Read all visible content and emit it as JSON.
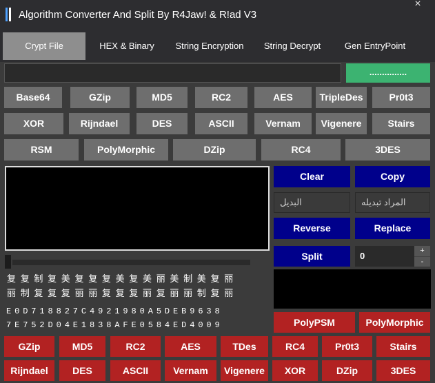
{
  "window": {
    "title": "Algorithm Converter And Split By R4Jaw! & R!ad V3",
    "close_label": "×"
  },
  "tabs": [
    {
      "label": "Crypt File",
      "active": true
    },
    {
      "label": "HEX & Binary",
      "active": false
    },
    {
      "label": "String Encryption",
      "active": false
    },
    {
      "label": "String Decrypt",
      "active": false
    },
    {
      "label": "Gen EntryPoint",
      "active": false
    }
  ],
  "path_input": {
    "value": ""
  },
  "browse_button": {
    "label": "..............."
  },
  "algo_row1": [
    "Base64",
    "GZip",
    "MD5",
    "RC2",
    "AES",
    "TripleDes",
    "Pr0t3"
  ],
  "algo_row2": [
    "XOR",
    "Rijndael",
    "DES",
    "ASCII",
    "Vernam",
    "Vigenere",
    "Stairs"
  ],
  "algo_row3": [
    "RSM",
    "PolyMorphic",
    "DZip",
    "RC4",
    "3DES"
  ],
  "actions": {
    "clear": "Clear",
    "copy": "Copy",
    "reverse": "Reverse",
    "replace": "Replace",
    "split": "Split"
  },
  "replace_with": {
    "placeholder": "البديل"
  },
  "to_replace": {
    "placeholder": "المراد تبديله"
  },
  "split_count": {
    "value": "0",
    "up": "+",
    "down": "-"
  },
  "preview": {
    "cjk_line1": "复复制复美复复复美复美丽美制美复丽",
    "cjk_line2": "丽制复复复丽丽复复复丽复丽丽制复丽",
    "hex_line1": "E0D718827C4921980A5DEB9638",
    "hex_line2": "7E752D04E1838AFE0584ED4009"
  },
  "poly_buttons": [
    "PolyPSM",
    "PolyMorphic"
  ],
  "red_row1": [
    "GZip",
    "MD5",
    "RC2",
    "AES",
    "TDes",
    "RC4",
    "Pr0t3",
    "Stairs"
  ],
  "red_row2": [
    "Rijndael",
    "DES",
    "ASCII",
    "Vernam",
    "Vigenere",
    "XOR",
    "DZip",
    "3DES"
  ],
  "colors": {
    "accent_green": "#3cb371",
    "button_gray": "#6e6e6e",
    "button_blue": "#00008b",
    "button_red": "#b22222",
    "background": "#3b3b3b"
  }
}
